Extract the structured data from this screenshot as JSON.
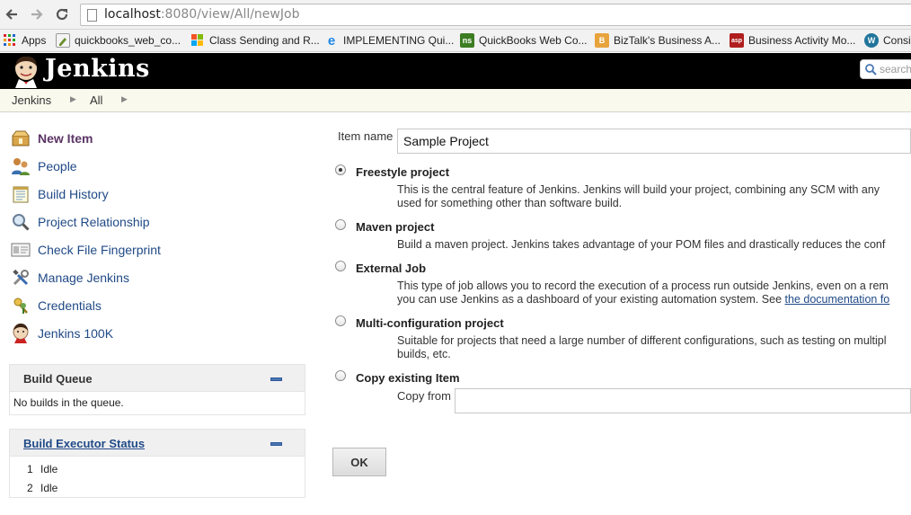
{
  "browser": {
    "url_host": "localhost",
    "url_rest": ":8080/view/All/newJob",
    "bookmarks": [
      {
        "label": "Apps",
        "icon": "apps-grid-icon"
      },
      {
        "label": "quickbooks_web_co...",
        "icon": "pencil-bookmark-icon"
      },
      {
        "label": "Class Sending and R...",
        "icon": "windows-logo-icon"
      },
      {
        "label": "IMPLEMENTING Qui...",
        "icon": "ie-logo-icon"
      },
      {
        "label": "QuickBooks Web Co...",
        "icon": "ns-logo-icon"
      },
      {
        "label": "BizTalk's Business A...",
        "icon": "biztalk-icon"
      },
      {
        "label": "Business Activity Mo...",
        "icon": "asp-logo-icon"
      },
      {
        "label": "Consi",
        "icon": "wordpress-icon"
      }
    ]
  },
  "header": {
    "logo_text": "Jenkins",
    "search_placeholder": "search"
  },
  "breadcrumb": [
    "Jenkins",
    "All"
  ],
  "sidebar": {
    "tasks": [
      {
        "label": "New Item",
        "icon": "new-item-icon"
      },
      {
        "label": "People",
        "icon": "people-icon"
      },
      {
        "label": "Build History",
        "icon": "notepad-icon"
      },
      {
        "label": "Project Relationship",
        "icon": "magnifier-icon"
      },
      {
        "label": "Check File Fingerprint",
        "icon": "fingerprint-icon"
      },
      {
        "label": "Manage Jenkins",
        "icon": "tools-icon"
      },
      {
        "label": "Credentials",
        "icon": "credentials-icon"
      },
      {
        "label": "Jenkins 100K",
        "icon": "jenkins-face-icon"
      }
    ],
    "build_queue": {
      "title": "Build Queue",
      "empty_text": "No builds in the queue."
    },
    "executors": {
      "title": "Build Executor Status",
      "rows": [
        {
          "num": "1",
          "status": "Idle"
        },
        {
          "num": "2",
          "status": "Idle"
        }
      ]
    }
  },
  "form": {
    "item_name_label": "Item name",
    "item_name_value": "Sample Project",
    "options": [
      {
        "title": "Freestyle project",
        "selected": true,
        "desc": [
          "This is the central feature of Jenkins. Jenkins will build your project, combining any SCM with any",
          "used for something other than software build."
        ]
      },
      {
        "title": "Maven project",
        "selected": false,
        "desc": [
          "Build a maven project. Jenkins takes advantage of your POM files and drastically reduces the conf"
        ]
      },
      {
        "title": "External Job",
        "selected": false,
        "desc": [
          "This type of job allows you to record the execution of a process run outside Jenkins, even on a rem",
          "you can use Jenkins as a dashboard of your existing automation system. See"
        ],
        "link": "the documentation fo"
      },
      {
        "title": "Multi-configuration project",
        "selected": false,
        "desc": [
          "Suitable for projects that need a large number of different configurations, such as testing on multipl",
          "builds, etc."
        ]
      },
      {
        "title": "Copy existing Item",
        "selected": false,
        "desc": []
      }
    ],
    "copy_from_label": "Copy from",
    "copy_from_value": "",
    "ok_label": "OK"
  }
}
